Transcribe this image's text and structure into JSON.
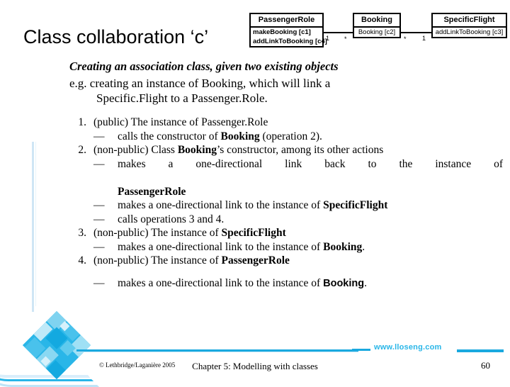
{
  "slide": {
    "title": "Class collaboration ‘c’"
  },
  "diagram": {
    "name": "uml-class-collaboration",
    "classes": [
      {
        "name": "PassengerRole",
        "operations": "makeBooking [c1]\naddLinkToBooking [c4]",
        "op_line_1": "makeBooking [c1]",
        "op_line_2": "addLinkToBooking [c4]"
      },
      {
        "name": "Booking",
        "operations": "Booking [c2]",
        "op_line_1": "Booking [c2]"
      },
      {
        "name": "SpecificFlight",
        "operations": "addLinkToBooking [c3]",
        "op_line_1": "addLinkToBooking [c3]"
      }
    ],
    "multiplicities": {
      "passengerrole_end": "1",
      "booking_left_end": "*",
      "booking_right_end": "*",
      "specificflight_end": "1"
    }
  },
  "content": {
    "lead_heading": "Creating an association class, given two existing objects",
    "example_line_1": "e.g. creating an instance of Booking, which will link a",
    "example_line_2": "Specific.Flight to a Passenger.Role.",
    "steps": [
      {
        "number": "1.",
        "text_plain": "(public) The instance of Passenger.Role",
        "text_prefix": "(public) The instance of Passenger.Role",
        "substeps": [
          {
            "dash": "—",
            "prefix": "calls the constructor of ",
            "bold": "Booking",
            "suffix": " (operation 2)."
          }
        ]
      },
      {
        "number": "2.",
        "text_prefix": "(non-public) Class ",
        "text_bold": "Booking",
        "text_suffix": "’s constructor, among its other actions",
        "substeps": [
          {
            "dash": "—",
            "prefix": "makes a one-directional link back to the instance of",
            "bold": "PassengerRole",
            "suffix": ""
          },
          {
            "dash": "—",
            "prefix": "makes a one-directional link to the instance of ",
            "bold": "SpecificFlight",
            "suffix": ""
          },
          {
            "dash": "—",
            "prefix": "calls operations 3 and 4.",
            "bold": "",
            "suffix": ""
          }
        ]
      },
      {
        "number": "3.",
        "text_prefix": "(non-public) The instance of ",
        "text_bold": "SpecificFlight",
        "text_suffix": "",
        "substeps": [
          {
            "dash": "—",
            "prefix": "makes a one-directional link to the instance of ",
            "bold": "Booking",
            "suffix": "."
          }
        ]
      },
      {
        "number": "4.",
        "text_prefix": "(non-public) The instance of ",
        "text_bold": "PassengerRole",
        "text_suffix": "",
        "substeps": [
          {
            "dash": "—",
            "prefix": "makes a one-directional link to the instance of ",
            "bold": "Booking",
            "suffix": "."
          }
        ]
      }
    ]
  },
  "footer": {
    "site_url": "www.lloseng.com",
    "copyright": "© Lethbridge/Laganière 2005",
    "chapter": "Chapter 5: Modelling with classes",
    "page_number": "60"
  },
  "colors": {
    "accent_cyan": "#29b6e8",
    "accent_rule": "#1aa9df",
    "accent_pale": "#bfe4f7"
  }
}
